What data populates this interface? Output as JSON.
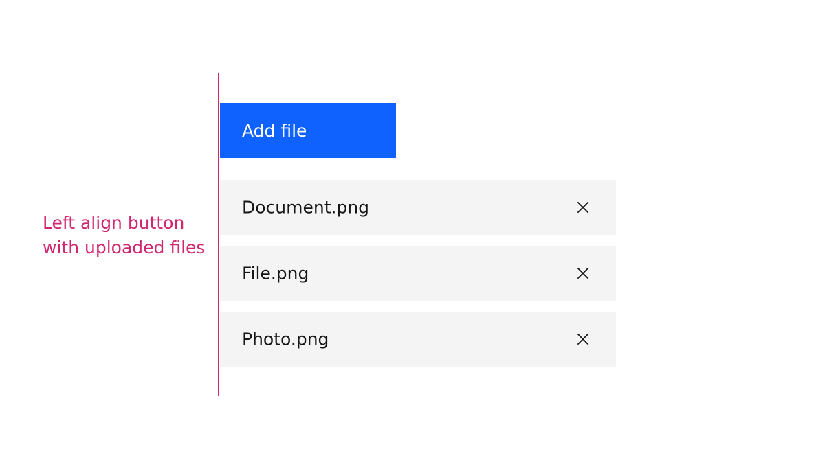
{
  "annotation": {
    "line1": "Left align button",
    "line2": "with uploaded files",
    "color": "#d12771"
  },
  "uploader": {
    "add_button_label": "Add file",
    "button_color": "#0f62fe",
    "files": [
      {
        "name": "Document.png",
        "remove_icon": "close-icon"
      },
      {
        "name": "File.png",
        "remove_icon": "close-icon"
      },
      {
        "name": "Photo.png",
        "remove_icon": "close-icon"
      }
    ]
  }
}
